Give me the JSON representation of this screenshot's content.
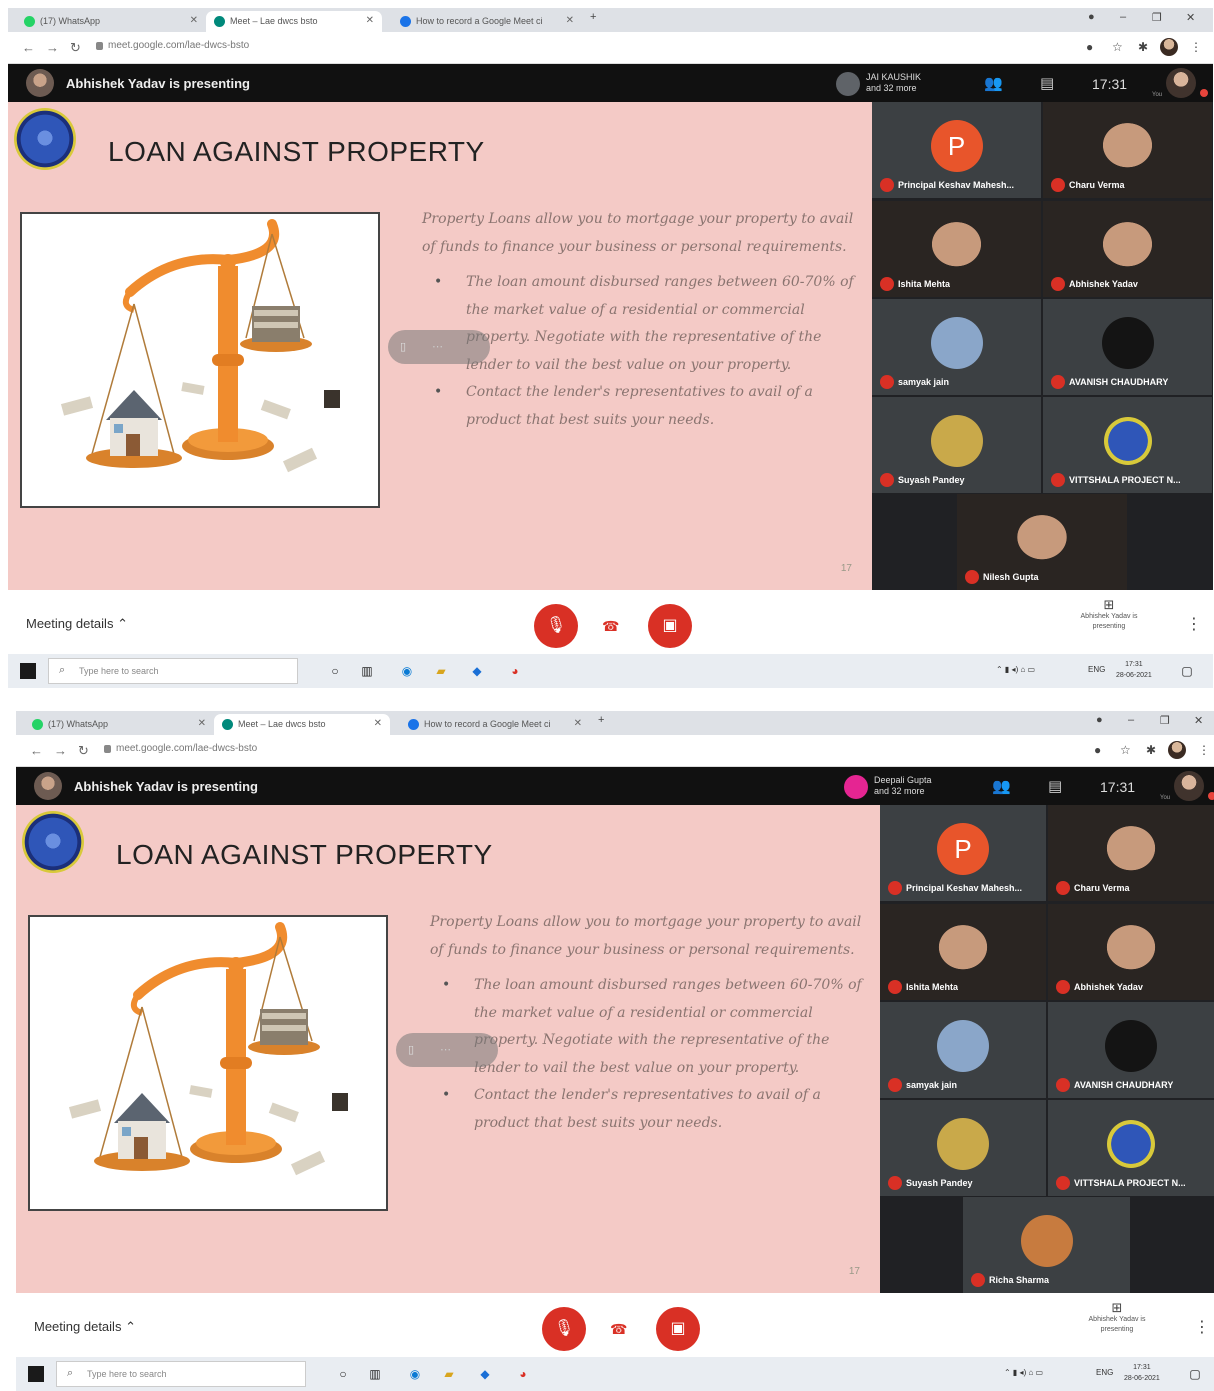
{
  "screenshots": [
    {
      "browser": {
        "tabs": [
          {
            "title": "(17) WhatsApp",
            "favicon_color": "#25d366"
          },
          {
            "title": "Meet – Lae dwcs bsto",
            "favicon_color": "#00897b",
            "active": true
          },
          {
            "title": "How to record a Google Meet ci",
            "favicon_color": "#1a73e8"
          }
        ],
        "url": "meet.google.com/lae-dwcs-bsto"
      },
      "header": {
        "presenting": "Abhishek Yadav is presenting",
        "speaker_name": "JAI KAUSHIK",
        "speaker_more": "and 32 more",
        "speaker_color": "#5f6368",
        "time": "17:31",
        "you_label": "You"
      },
      "slide": {
        "title": "LOAN AGAINST PROPERTY",
        "intro": "Property Loans allow you to mortgage your property to avail of funds to finance your business or personal requirements.",
        "bullets": [
          "The loan amount disbursed ranges between 60-70% of the market value of a residential or commercial property. Negotiate with the representative of the lender to vail the best value on your property.",
          "Contact the lender's representatives to avail of a product that best suits your needs."
        ],
        "page": "17"
      },
      "participants": [
        {
          "name": "Principal Keshav Mahesh...",
          "type": "letter",
          "letter": "P"
        },
        {
          "name": "Charu Verma",
          "type": "video",
          "bg": "#b9b2a8"
        },
        {
          "name": "Ishita Mehta",
          "type": "video",
          "bg": "#6d7178"
        },
        {
          "name": "Abhishek Yadav",
          "type": "video",
          "bg": "#a8876d"
        },
        {
          "name": "samyak jain",
          "type": "avatar",
          "avatar_color": "#8aa6c9"
        },
        {
          "name": "AVANISH CHAUDHARY",
          "type": "avatar",
          "avatar_color": "#141414"
        },
        {
          "name": "Suyash Pandey",
          "type": "avatar",
          "avatar_color": "#c9a94a"
        },
        {
          "name": "VITTSHALA PROJECT N...",
          "type": "logo"
        },
        {
          "name": "Nilesh Gupta",
          "type": "video",
          "bg": "#b8b0a4"
        }
      ],
      "bottom": {
        "meeting_details": "Meeting details",
        "presenting_box": "Abhishek Yadav is presenting"
      },
      "taskbar": {
        "search_placeholder": "Type here to search",
        "time": "17:31",
        "date": "28-06-2021",
        "lang": "ENG"
      }
    },
    {
      "browser": {
        "tabs": [
          {
            "title": "(17) WhatsApp",
            "favicon_color": "#25d366"
          },
          {
            "title": "Meet – Lae dwcs bsto",
            "favicon_color": "#00897b",
            "active": true
          },
          {
            "title": "How to record a Google Meet ci",
            "favicon_color": "#1a73e8"
          }
        ],
        "url": "meet.google.com/lae-dwcs-bsto"
      },
      "header": {
        "presenting": "Abhishek Yadav is presenting",
        "speaker_name": "Deepali Gupta",
        "speaker_more": "and 32 more",
        "speaker_color": "#e52592",
        "time": "17:31",
        "you_label": "You"
      },
      "slide": {
        "title": "LOAN AGAINST PROPERTY",
        "intro": "Property Loans allow you to mortgage your property to avail of funds to finance your business or personal requirements.",
        "bullets": [
          "The loan amount disbursed ranges between 60-70% of the market value of a residential or commercial property. Negotiate with the representative of the lender to vail the best value on your property.",
          "Contact the lender's representatives to avail of a product that best suits your needs."
        ],
        "page": "17"
      },
      "participants": [
        {
          "name": "Principal Keshav Mahesh...",
          "type": "letter",
          "letter": "P"
        },
        {
          "name": "Charu Verma",
          "type": "video",
          "bg": "#b9b2a8"
        },
        {
          "name": "Ishita Mehta",
          "type": "video",
          "bg": "#6d7178"
        },
        {
          "name": "Abhishek Yadav",
          "type": "video",
          "bg": "#a8876d"
        },
        {
          "name": "samyak jain",
          "type": "avatar",
          "avatar_color": "#8aa6c9"
        },
        {
          "name": "AVANISH CHAUDHARY",
          "type": "avatar",
          "avatar_color": "#141414"
        },
        {
          "name": "Suyash Pandey",
          "type": "avatar",
          "avatar_color": "#c9a94a"
        },
        {
          "name": "VITTSHALA PROJECT N...",
          "type": "logo"
        },
        {
          "name": "Richa Sharma",
          "type": "avatar",
          "avatar_color": "#c77b3f"
        }
      ],
      "bottom": {
        "meeting_details": "Meeting details",
        "presenting_box": "Abhishek Yadav is presenting"
      },
      "taskbar": {
        "search_placeholder": "Type here to search",
        "time": "17:31",
        "date": "28-06-2021",
        "lang": "ENG"
      }
    }
  ]
}
